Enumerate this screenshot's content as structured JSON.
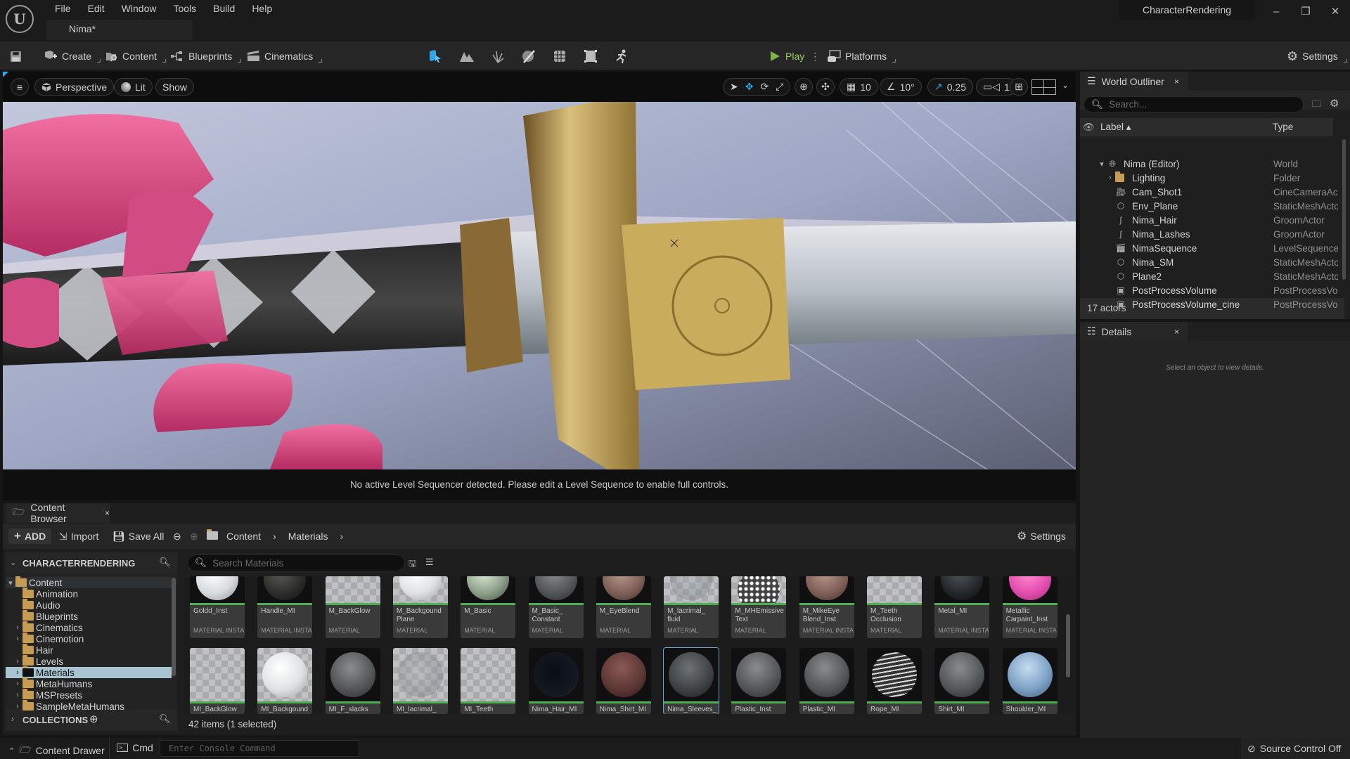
{
  "window": {
    "project_name": "CharacterRendering",
    "level_tab": "Nima*",
    "menu": [
      "File",
      "Edit",
      "Window",
      "Tools",
      "Build",
      "Help"
    ],
    "controls": {
      "minimize": "–",
      "restore": "❐",
      "close": "✕"
    }
  },
  "toolbar": {
    "create": "Create",
    "content": "Content",
    "blueprints": "Blueprints",
    "cinematics": "Cinematics",
    "play": "Play",
    "platforms": "Platforms",
    "settings": "Settings",
    "modes": [
      "select-mode",
      "landscape-mode",
      "foliage-mode",
      "mesh-paint-mode",
      "fracture-mode",
      "brush-edit-mode",
      "animation-mode"
    ]
  },
  "viewport": {
    "perspective": "Perspective",
    "lit": "Lit",
    "show": "Show",
    "grid_snap": "10",
    "rotation_snap": "10°",
    "scale_snap": "0.25",
    "camera_speed": "1",
    "sequencer_message": "No active Level Sequencer detected. Please edit a Level Sequence to enable full controls."
  },
  "outliner": {
    "title": "World Outliner",
    "search_placeholder": "Search...",
    "col_label": "Label",
    "col_type": "Type",
    "rows": [
      {
        "label": "Nima (Editor)",
        "type": "World",
        "icon": "world-icon",
        "indent": 0,
        "expand": "▾"
      },
      {
        "label": "Lighting",
        "type": "Folder",
        "icon": "folder-icon",
        "indent": 1,
        "expand": "›"
      },
      {
        "label": "Cam_Shot1",
        "type": "CineCameraActor",
        "icon": "camera-icon",
        "indent": 1,
        "expand": ""
      },
      {
        "label": "Env_Plane",
        "type": "StaticMeshActor",
        "icon": "static-mesh-icon",
        "indent": 1,
        "expand": ""
      },
      {
        "label": "Nima_Hair",
        "type": "GroomActor",
        "icon": "groom-icon",
        "indent": 1,
        "expand": ""
      },
      {
        "label": "Nima_Lashes",
        "type": "GroomActor",
        "icon": "groom-icon",
        "indent": 1,
        "expand": ""
      },
      {
        "label": "NimaSequence",
        "type": "LevelSequenceActor",
        "icon": "sequence-icon",
        "indent": 1,
        "expand": ""
      },
      {
        "label": "Nima_SM",
        "type": "StaticMeshActor",
        "icon": "static-mesh-icon",
        "indent": 1,
        "expand": ""
      },
      {
        "label": "Plane2",
        "type": "StaticMeshActor",
        "icon": "static-mesh-icon",
        "indent": 1,
        "expand": ""
      },
      {
        "label": "PostProcessVolume",
        "type": "PostProcessVolume",
        "icon": "volume-icon",
        "indent": 1,
        "expand": ""
      },
      {
        "label": "PostProcessVolume_cine",
        "type": "PostProcessVolume",
        "icon": "volume-icon",
        "indent": 1,
        "expand": ""
      }
    ],
    "actor_count": "17 actors"
  },
  "details": {
    "title": "Details",
    "empty_message": "Select an object to view details."
  },
  "content_browser": {
    "title": "Content Browser",
    "add": "ADD",
    "import": "Import",
    "save_all": "Save All",
    "breadcrumb": [
      "Content",
      "Materials"
    ],
    "settings": "Settings",
    "sources_title": "CHARACTERRENDERING",
    "collections_title": "COLLECTIONS",
    "search_placeholder": "Search Materials",
    "tree": [
      {
        "label": "Content",
        "indent": 0,
        "expand": "▾",
        "selected": false,
        "open": true
      },
      {
        "label": "Animation",
        "indent": 1,
        "expand": "",
        "selected": false
      },
      {
        "label": "Audio",
        "indent": 1,
        "expand": "",
        "selected": false
      },
      {
        "label": "Blueprints",
        "indent": 1,
        "expand": "",
        "selected": false
      },
      {
        "label": "Cinematics",
        "indent": 1,
        "expand": "›",
        "selected": false
      },
      {
        "label": "Cinemotion",
        "indent": 1,
        "expand": "›",
        "selected": false
      },
      {
        "label": "Hair",
        "indent": 1,
        "expand": "",
        "selected": false
      },
      {
        "label": "Levels",
        "indent": 1,
        "expand": "›",
        "selected": false
      },
      {
        "label": "Materials",
        "indent": 1,
        "expand": "›",
        "selected": true
      },
      {
        "label": "MetaHumans",
        "indent": 1,
        "expand": "›",
        "selected": false
      },
      {
        "label": "MSPresets",
        "indent": 1,
        "expand": "›",
        "selected": false
      },
      {
        "label": "SampleMetaHumans",
        "indent": 1,
        "expand": "›",
        "selected": false
      }
    ],
    "assets_row1": [
      {
        "name": "Goldd_Inst",
        "kind": "MATERIAL INSTA",
        "thumb": "sphere-white"
      },
      {
        "name": "Handle_MI",
        "kind": "MATERIAL INSTA",
        "thumb": "sphere-dark"
      },
      {
        "name": "M_BackGlow",
        "kind": "MATERIAL",
        "thumb": "checker"
      },
      {
        "name": "M_Backgound Plane",
        "kind": "MATERIAL",
        "thumb": "sphere-white-checker"
      },
      {
        "name": "M_Basic",
        "kind": "MATERIAL",
        "thumb": "sphere-green"
      },
      {
        "name": "M_Basic_ Constant",
        "kind": "MATERIAL",
        "thumb": "sphere-grey"
      },
      {
        "name": "M_EyeBlend",
        "kind": "MATERIAL",
        "thumb": "sphere-skin"
      },
      {
        "name": "M_lacrimal_ fluid",
        "kind": "MATERIAL",
        "thumb": "sphere-glass"
      },
      {
        "name": "M_MHEmissive Text",
        "kind": "MATERIAL",
        "thumb": "emissive"
      },
      {
        "name": "M_MikeEye Blend_Inst",
        "kind": "MATERIAL INSTA",
        "thumb": "sphere-skin"
      },
      {
        "name": "M_Teeth Occlusion",
        "kind": "MATERIAL",
        "thumb": "checker"
      },
      {
        "name": "Metal_MI",
        "kind": "MATERIAL INSTA",
        "thumb": "sphere-metal"
      },
      {
        "name": "Metallic Carpaint_Inst",
        "kind": "MATERIAL INSTA",
        "thumb": "sphere-pink"
      }
    ],
    "assets_row2": [
      {
        "name": "MI_BackGlow",
        "thumb": "checker"
      },
      {
        "name": "MI_Backgound",
        "thumb": "sphere-white-checker"
      },
      {
        "name": "MI_F_slacks",
        "thumb": "sphere-grey"
      },
      {
        "name": "MI_lacrimal_",
        "thumb": "sphere-glass"
      },
      {
        "name": "MI_Teeth",
        "thumb": "checker"
      },
      {
        "name": "Nima_Hair_MI",
        "thumb": "sphere-black"
      },
      {
        "name": "Nima_Shirt_MI",
        "thumb": "sphere-red"
      },
      {
        "name": "Nima_Sleeves_",
        "thumb": "sphere-lines",
        "selected": true
      },
      {
        "name": "Plastic_Inst",
        "thumb": "sphere-grey"
      },
      {
        "name": "Plastic_MI",
        "thumb": "sphere-grey"
      },
      {
        "name": "Rope_MI",
        "thumb": "sphere-rope"
      },
      {
        "name": "Shirt_MI",
        "thumb": "sphere-grey"
      },
      {
        "name": "Shoulder_MI",
        "thumb": "sphere-blue"
      }
    ],
    "item_count": "42 items (1 selected)"
  },
  "statusbar": {
    "content_drawer": "Content Drawer",
    "cmd": "Cmd",
    "console_placeholder": "Enter Console Command",
    "source_control": "Source Control Off"
  },
  "colors": {
    "accent_blue": "#2fa4e7",
    "play_green": "#7cb342",
    "asset_green": "#4caf50",
    "selection": "#a8c4d0"
  }
}
